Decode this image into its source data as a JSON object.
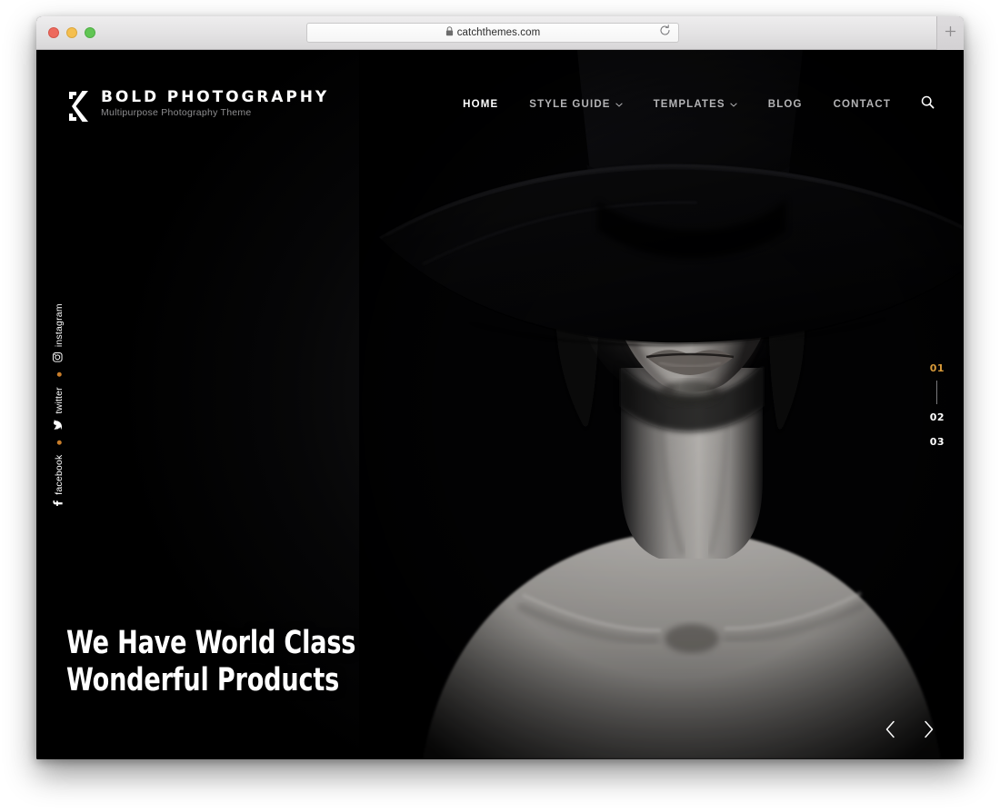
{
  "browser": {
    "url": "catchthemes.com",
    "lock_icon": "lock-icon",
    "reload_icon": "reload-icon",
    "new_tab_icon": "plus-icon",
    "traffic_lights": [
      "close",
      "minimize",
      "maximize"
    ]
  },
  "site": {
    "brand": {
      "logo_icon": "k-monogram-logo",
      "title": "BOLD PHOTOGRAPHY",
      "tagline": "Multipurpose Photography Theme"
    },
    "nav": {
      "items": [
        {
          "label": "HOME",
          "active": true,
          "has_dropdown": false
        },
        {
          "label": "STYLE GUIDE",
          "active": false,
          "has_dropdown": true
        },
        {
          "label": "TEMPLATES",
          "active": false,
          "has_dropdown": true
        },
        {
          "label": "BLOG",
          "active": false,
          "has_dropdown": false
        },
        {
          "label": "CONTACT",
          "active": false,
          "has_dropdown": false
        }
      ],
      "search_icon": "search-icon"
    },
    "social": [
      {
        "label": "facebook",
        "icon": "facebook-icon"
      },
      {
        "label": "twitter",
        "icon": "twitter-icon"
      },
      {
        "label": "instagram",
        "icon": "instagram-icon"
      }
    ],
    "hero": {
      "title": "We Have World Class Wonderful Products",
      "image_description": "black-and-white portrait of a woman wearing a wide-brim hat",
      "slides": [
        {
          "number": "01",
          "active": true
        },
        {
          "number": "02",
          "active": false
        },
        {
          "number": "03",
          "active": false
        }
      ],
      "prev_icon": "chevron-left-icon",
      "next_icon": "chevron-right-icon"
    }
  },
  "colors": {
    "accent": "#d89a3a",
    "dot": "#c87d2a",
    "background": "#000000",
    "nav_inactive": "#b4b4b6",
    "tagline": "#8e8e90"
  }
}
